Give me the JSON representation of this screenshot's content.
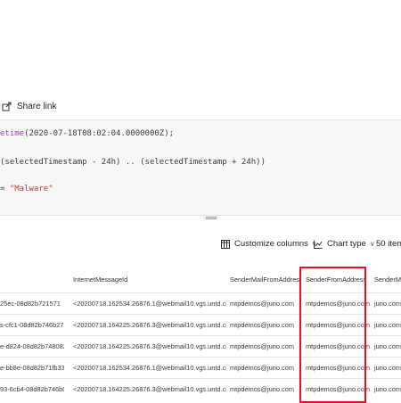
{
  "toolbar": {
    "share_label": "Share link",
    "share_icon": "share-icon"
  },
  "editor": {
    "line1": {
      "fn": "etime",
      "arg": "(2020-07-18T08:02:04.0000000Z);"
    },
    "line2": "(selectedTimestamp - 24h) .. (selectedTimestamp + 24h))",
    "line3": {
      "prefix": "= ",
      "str": "\"Malware\""
    }
  },
  "results_toolbar": {
    "customize_columns": "Customize columns",
    "chart_type": "Chart type",
    "items_count": "50 item"
  },
  "colors": {
    "highlight": "#e81123",
    "keyword": "#9b42b1",
    "string": "#c0392b"
  },
  "table": {
    "columns": [
      "",
      "InternetMessageId",
      "SenderMailFromAddress",
      "SenderFromAddress",
      "SenderMa"
    ],
    "rows": [
      [
        "25ec-08d82b721571",
        "<20200718.162534.26876.1@webmail10.vgs.untd.com>",
        "mtpdemos@juno.com",
        "mtpdemos@juno.com",
        "juno.com"
      ],
      [
        "s-cfc1-08d82b746b27",
        "<20200718.164225.26876.3@webmail10.vgs.untd.com>",
        "mtpdemos@juno.com",
        "mtpdemos@juno.com",
        "juno.com"
      ],
      [
        "e-d824-08d82b748083",
        "<20200718.164225.26876.3@webmail10.vgs.untd.com>",
        "mtpdemos@juno.com",
        "mtpdemos@juno.com",
        "juno.com"
      ],
      [
        "e-bb8e-08d82b71fb33",
        "<20200718.162534.26876.1@webmail10.vgs.untd.com>",
        "mtpdemos@juno.com",
        "mtpdemos@juno.com",
        "juno.com"
      ],
      [
        "93-6cb4-08d82b746b03",
        "<20200718.164225.26876.3@webmail10.vgs.untd.com>",
        "mtpdemos@juno.com",
        "mtpdemos@juno.com",
        "juno.com"
      ]
    ]
  }
}
